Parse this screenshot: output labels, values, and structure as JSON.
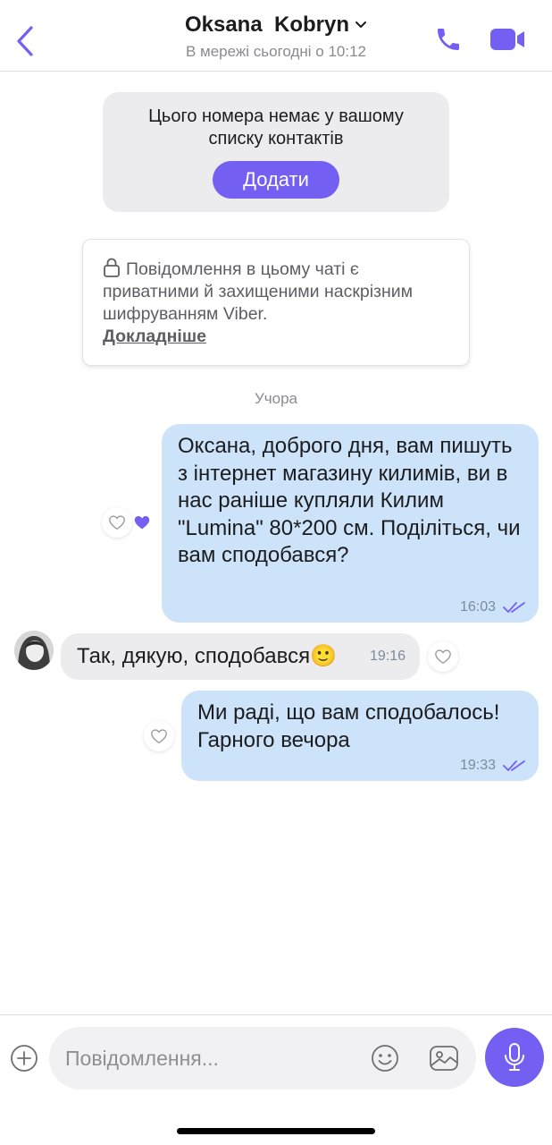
{
  "header": {
    "contact_name": "Oksana  Kobryn",
    "status": "В мережі сьогодні о 10:12"
  },
  "add_contact": {
    "text": "Цього номера немає у вашому списку контактів",
    "button_label": "Додати"
  },
  "encryption_notice": {
    "text": "Повідомлення в цьому чаті є приватними й захищеними наскрізним шифруванням Viber.",
    "link_label": "Докладніше"
  },
  "date_separator": "Учора",
  "messages": [
    {
      "direction": "outgoing",
      "text": "Оксана, доброго дня, вам пишуть з інтернет магазину килимів, ви в нас раніше купляли Килим \"Lumina\" 80*200 см. Поділіться, чи вам сподобався?",
      "time": "16:03",
      "status": "read",
      "liked": true
    },
    {
      "direction": "incoming",
      "text": "Так, дякую, сподобався🙂",
      "time": "19:16",
      "liked": false
    },
    {
      "direction": "outgoing",
      "text": "Ми раді, що вам сподобалось! Гарного вечора",
      "time": "19:33",
      "status": "read",
      "liked": false
    }
  ],
  "composer": {
    "placeholder": "Повідомлення..."
  },
  "icons": {
    "back": "chevron-left-icon",
    "call": "phone-icon",
    "video": "video-camera-icon",
    "lock": "lock-icon",
    "heart": "heart-icon",
    "read": "double-check-icon",
    "plus": "plus-circle-icon",
    "emoji": "smiley-icon",
    "gallery": "gallery-icon",
    "mic": "microphone-icon"
  },
  "colors": {
    "accent": "#7360f2",
    "outgoing_bubble": "#cce3fa",
    "incoming_bubble": "#ececef",
    "read_check": "#7360f2"
  }
}
